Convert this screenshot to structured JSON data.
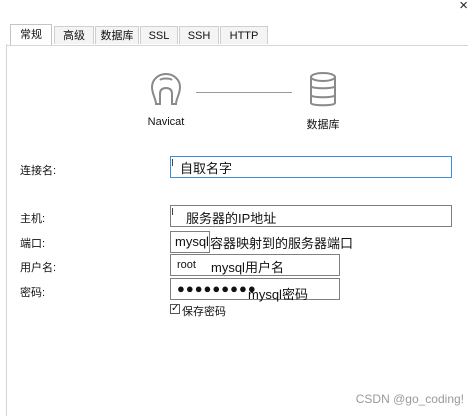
{
  "window": {
    "close_glyph": "×"
  },
  "tabs": [
    {
      "label": "常规",
      "active": true
    },
    {
      "label": "高级"
    },
    {
      "label": "数据库"
    },
    {
      "label": "SSL"
    },
    {
      "label": "SSH"
    },
    {
      "label": "HTTP"
    }
  ],
  "header": {
    "left_icon": "navicat-icon",
    "left_label": "Navicat",
    "right_icon": "database-icon",
    "right_label": "数据库"
  },
  "form": {
    "connection_name": {
      "label": "连接名:",
      "value": "",
      "note": "自取名字"
    },
    "host": {
      "label": "主机:",
      "value": "",
      "note": "服务器的IP地址"
    },
    "port": {
      "label": "端口:",
      "value": "mysql",
      "note": "容器映射到的服务器端口"
    },
    "username": {
      "label": "用户名:",
      "value": "root",
      "note": "mysql用户名"
    },
    "password": {
      "label": "密码:",
      "value": "●●●●●●●●●",
      "note": "mysql密码"
    },
    "save_password": {
      "label": "保存密码",
      "checked": true,
      "check_glyph": "✓"
    }
  },
  "watermark": "CSDN @go_coding!"
}
